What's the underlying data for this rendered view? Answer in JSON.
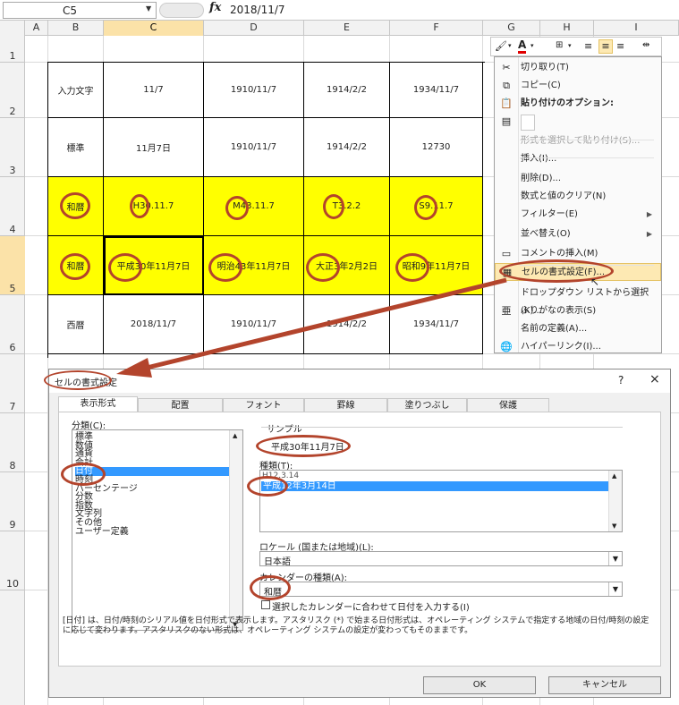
{
  "formula_bar": {
    "name_box": "C5",
    "fx_label": "fx",
    "value": "2018/11/7"
  },
  "column_headers": [
    "A",
    "B",
    "C",
    "D",
    "E",
    "F",
    "G",
    "H",
    "I"
  ],
  "row_headers": [
    "1",
    "2",
    "3",
    "4",
    "5",
    "6",
    "7",
    "8",
    "9",
    "10"
  ],
  "rows": [
    {
      "label": "入力文字",
      "cells": [
        "11/7",
        "1910/11/7",
        "1914/2/2",
        "1934/11/7"
      ]
    },
    {
      "label": "標準",
      "cells": [
        "11月7日",
        "1910/11/7",
        "1914/2/2",
        "12730"
      ]
    },
    {
      "label": "和暦",
      "cells": [
        "H30.11.7",
        "M43.11.7",
        "T3.2.2",
        "S9.11.7"
      ]
    },
    {
      "label": "和暦",
      "cells": [
        "平成30年11月7日",
        "明治43年11月7日",
        "大正3年2月2日",
        "昭和9年11月7日"
      ]
    },
    {
      "label": "西暦",
      "cells": [
        "2018/11/7",
        "1910/11/7",
        "1914/2/2",
        "1934/11/7"
      ]
    }
  ],
  "context_menu": {
    "items": [
      {
        "icon": "scissors-icon",
        "glyph": "✂",
        "label": "切り取り(T)"
      },
      {
        "icon": "copy-icon",
        "glyph": "⧉",
        "label": "コピー(C)"
      },
      {
        "icon": "paste-icon",
        "glyph": "📋",
        "label": "貼り付けのオプション:",
        "bold": true
      },
      {
        "icon": "paste-values-icon",
        "glyph": "▤",
        "label": ""
      },
      {
        "icon": "",
        "glyph": "",
        "label": "形式を選択して貼り付け(S)...",
        "disabled": true
      },
      {
        "icon": "",
        "glyph": "",
        "label": "挿入(I)..."
      },
      {
        "icon": "",
        "glyph": "",
        "label": "削除(D)..."
      },
      {
        "icon": "",
        "glyph": "",
        "label": "数式と値のクリア(N)"
      },
      {
        "icon": "",
        "glyph": "",
        "label": "フィルター(E)",
        "submenu": true
      },
      {
        "icon": "",
        "glyph": "",
        "label": "並べ替え(O)",
        "submenu": true
      },
      {
        "icon": "comment-icon",
        "glyph": "▭",
        "label": "コメントの挿入(M)"
      },
      {
        "icon": "format-cells-icon",
        "glyph": "▦",
        "label": "セルの書式設定(F)...",
        "highlight": true
      },
      {
        "icon": "",
        "glyph": "",
        "label": "ドロップダウン リストから選択(K)..."
      },
      {
        "icon": "furigana-icon",
        "glyph": "亜",
        "label": "ふりがなの表示(S)"
      },
      {
        "icon": "",
        "glyph": "",
        "label": "名前の定義(A)..."
      },
      {
        "icon": "hyperlink-icon",
        "glyph": "🌐",
        "label": "ハイパーリンク(I)..."
      }
    ]
  },
  "dialog": {
    "title": "セルの書式設定",
    "help": "?",
    "close": "×",
    "tabs": [
      "表示形式",
      "配置",
      "フォント",
      "罫線",
      "塗りつぶし",
      "保護"
    ],
    "category_label": "分類(C):",
    "categories": [
      "標準",
      "数値",
      "通貨",
      "会計",
      "日付",
      "時刻",
      "パーセンテージ",
      "分数",
      "指数",
      "文字列",
      "その他",
      "ユーザー定義"
    ],
    "selected_category": "日付",
    "sample_label": "サンプル",
    "sample_value": "平成30年11月7日",
    "type_label": "種類(T):",
    "types": [
      "H12.3.14",
      "平成12年3月14日"
    ],
    "locale_label": "ロケール (国または地域)(L):",
    "locale_value": "日本語",
    "calendar_label": "カレンダーの種類(A):",
    "calendar_value": "和暦",
    "checkbox_label": "選択したカレンダーに合わせて日付を入力する(I)",
    "description": "[日付] は、日付/時刻のシリアル値を日付形式で表示します。アスタリスク (*) で始まる日付形式は、オペレーティング システムで指定する地域の日付/時刻の設定に応じて変わります。アスタリスクのない形式は、オペレーティング システムの設定が変わってもそのままです。",
    "ok": "OK",
    "cancel": "キャンセル"
  },
  "colors": {
    "highlight": "#ffff00",
    "annotation": "#b3442c",
    "selection": "#3399ff"
  }
}
